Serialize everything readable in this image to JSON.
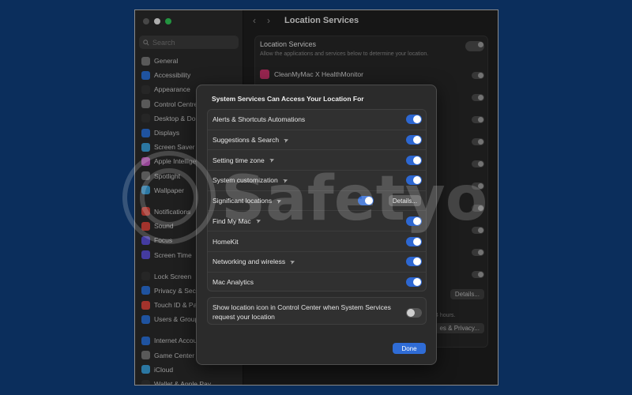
{
  "colors": {
    "accent": "#2d67d2",
    "desktop": "#0b2e5c",
    "watermark": "#ffffff"
  },
  "sidebar": {
    "search_placeholder": "Search",
    "groups": [
      [
        {
          "label": "General",
          "color": "#777777",
          "icon": "gear-icon"
        },
        {
          "label": "Accessibility",
          "color": "#2a6fd6",
          "icon": "accessibility-icon"
        },
        {
          "label": "Appearance",
          "color": "#333333",
          "icon": "appearance-icon"
        },
        {
          "label": "Control Centre",
          "color": "#777777",
          "icon": "control-centre-icon"
        },
        {
          "label": "Desktop & Dock",
          "color": "#333333",
          "icon": "dock-icon"
        },
        {
          "label": "Displays",
          "color": "#2a6fd6",
          "icon": "display-icon"
        },
        {
          "label": "Screen Saver",
          "color": "#3a9fd8",
          "icon": "screen-saver-icon"
        },
        {
          "label": "Apple Intelligence",
          "color": "#c75cc7",
          "icon": "apple-intelligence-icon"
        },
        {
          "label": "Spotlight",
          "color": "#777777",
          "icon": "spotlight-icon"
        },
        {
          "label": "Wallpaper",
          "color": "#3a9fd8",
          "icon": "wallpaper-icon"
        }
      ],
      [
        {
          "label": "Notifications",
          "color": "#d9453b",
          "icon": "notifications-icon"
        },
        {
          "label": "Sound",
          "color": "#d9453b",
          "icon": "sound-icon"
        },
        {
          "label": "Focus",
          "color": "#5b4fd6",
          "icon": "focus-icon"
        },
        {
          "label": "Screen Time",
          "color": "#5b4fd6",
          "icon": "screen-time-icon"
        }
      ],
      [
        {
          "label": "Lock Screen",
          "color": "#333333",
          "icon": "lock-icon"
        },
        {
          "label": "Privacy & Security",
          "color": "#2a6fd6",
          "icon": "privacy-icon"
        },
        {
          "label": "Touch ID & Password",
          "color": "#d9453b",
          "icon": "fingerprint-icon"
        },
        {
          "label": "Users & Groups",
          "color": "#2a6fd6",
          "icon": "users-icon"
        }
      ],
      [
        {
          "label": "Internet Accounts",
          "color": "#2a6fd6",
          "icon": "at-icon"
        },
        {
          "label": "Game Center",
          "color": "#777777",
          "icon": "game-center-icon"
        },
        {
          "label": "iCloud",
          "color": "#3a9fd8",
          "icon": "icloud-icon"
        },
        {
          "label": "Wallet & Apple Pay",
          "color": "#333333",
          "icon": "wallet-icon"
        }
      ]
    ]
  },
  "toolbar": {
    "title": "Location Services",
    "back": "‹",
    "forward": "›"
  },
  "background_panel": {
    "title": "Location Services",
    "description": "Allow the applications and services below to determine your location.",
    "app_name": "CleanMyMac X HealthMonitor",
    "details_label": "Details...",
    "privacy_label": "es & Privacy...",
    "hours_text": "4 hours."
  },
  "sheet": {
    "title": "System Services Can Access Your Location For",
    "rows": [
      {
        "label": "Alerts & Shortcuts Automations",
        "arrow": false,
        "on": true
      },
      {
        "label": "Suggestions & Search",
        "arrow": true,
        "on": true
      },
      {
        "label": "Setting time zone",
        "arrow": true,
        "on": true
      },
      {
        "label": "System customization",
        "arrow": true,
        "on": true
      },
      {
        "label": "Significant locations",
        "arrow": true,
        "on": true,
        "details": "Details..."
      },
      {
        "label": "Find My Mac",
        "arrow": true,
        "on": true
      },
      {
        "label": "HomeKit",
        "arrow": false,
        "on": true
      },
      {
        "label": "Networking and wireless",
        "arrow": true,
        "on": true
      },
      {
        "label": "Mac Analytics",
        "arrow": false,
        "on": true
      }
    ],
    "location_icon_text": "Show location icon in Control Center when System Services request your location",
    "location_icon_on": false,
    "done_label": "Done"
  },
  "watermark": {
    "text": "Safetyo"
  }
}
